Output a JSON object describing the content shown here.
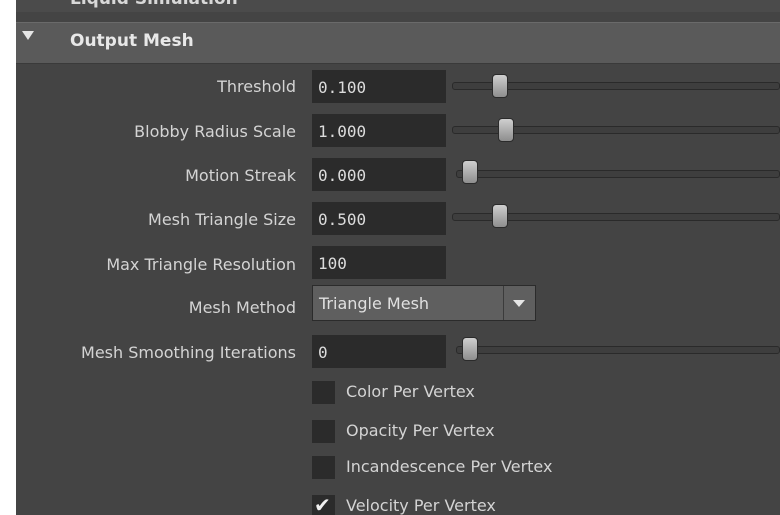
{
  "previous_section": {
    "title": "Liquid Simulation"
  },
  "section": {
    "title": "Output Mesh",
    "expanded": true
  },
  "attributes": {
    "threshold": {
      "label": "Threshold",
      "value": "0.100",
      "slider_fraction": 0.11
    },
    "blobby_radius_scale": {
      "label": "Blobby Radius Scale",
      "value": "1.000",
      "slider_fraction": 0.13
    },
    "motion_streak": {
      "label": "Motion Streak",
      "value": "0.000",
      "slider_fraction": 0.0
    },
    "mesh_triangle_size": {
      "label": "Mesh Triangle Size",
      "value": "0.500",
      "slider_fraction": 0.11
    },
    "max_triangle_resolution": {
      "label": "Max Triangle Resolution",
      "value": "100"
    },
    "mesh_method": {
      "label": "Mesh Method",
      "selected": "Triangle Mesh"
    },
    "mesh_smoothing_iterations": {
      "label": "Mesh Smoothing Iterations",
      "value": "0",
      "slider_fraction": 0.0
    }
  },
  "checkboxes": [
    {
      "label": "Color Per Vertex",
      "checked": false
    },
    {
      "label": "Opacity Per Vertex",
      "checked": false
    },
    {
      "label": "Incandescence Per Vertex",
      "checked": false
    },
    {
      "label": "Velocity Per Vertex",
      "checked": true
    }
  ],
  "colors": {
    "panel_bg": "#444444",
    "header_bg": "#5a5a5a",
    "field_bg": "#2b2b2b",
    "text": "#d4d4d4"
  }
}
